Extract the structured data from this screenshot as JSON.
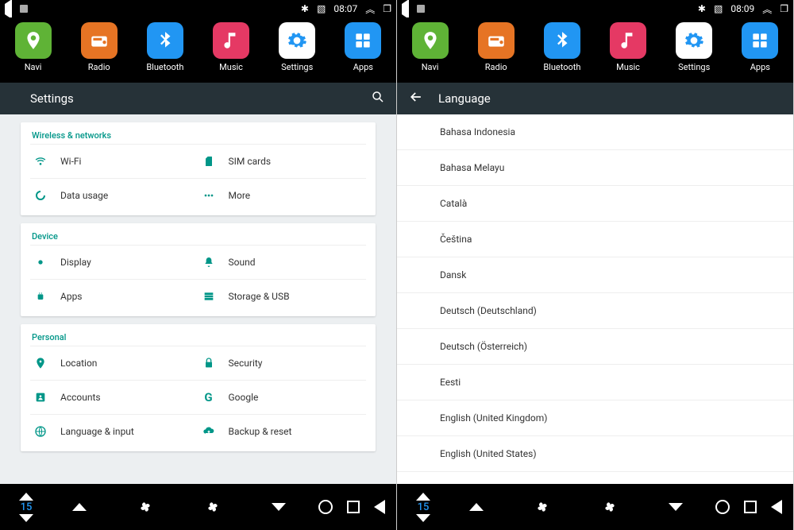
{
  "left": {
    "time": "08:07",
    "apps": [
      {
        "label": "Navi"
      },
      {
        "label": "Radio"
      },
      {
        "label": "Bluetooth"
      },
      {
        "label": "Music"
      },
      {
        "label": "Settings"
      },
      {
        "label": "Apps"
      }
    ],
    "header_title": "Settings",
    "sections": {
      "wireless": {
        "title": "Wireless & networks",
        "wifi": "Wi-Fi",
        "sim": "SIM cards",
        "data": "Data usage",
        "more": "More"
      },
      "device": {
        "title": "Device",
        "display": "Display",
        "sound": "Sound",
        "apps": "Apps",
        "storage": "Storage & USB"
      },
      "personal": {
        "title": "Personal",
        "location": "Location",
        "security": "Security",
        "accounts": "Accounts",
        "google": "Google",
        "language": "Language & input",
        "backup": "Backup & reset"
      }
    },
    "temperature": "15"
  },
  "right": {
    "time": "08:09",
    "apps": [
      {
        "label": "Navi"
      },
      {
        "label": "Radio"
      },
      {
        "label": "Bluetooth"
      },
      {
        "label": "Music"
      },
      {
        "label": "Settings"
      },
      {
        "label": "Apps"
      }
    ],
    "header_title": "Language",
    "languages": [
      "Bahasa Indonesia",
      "Bahasa Melayu",
      "Català",
      "Čeština",
      "Dansk",
      "Deutsch (Deutschland)",
      "Deutsch (Österreich)",
      "Eesti",
      "English (United Kingdom)",
      "English (United States)"
    ],
    "temperature": "15"
  }
}
